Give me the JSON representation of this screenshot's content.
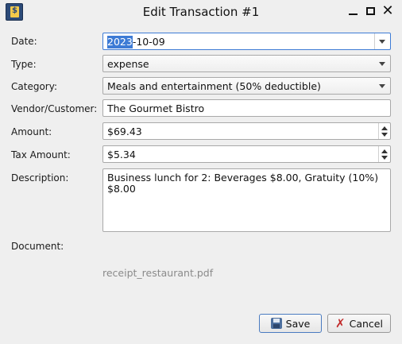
{
  "window": {
    "title": "Edit Transaction #1",
    "icons": [
      "app-icon",
      "minimize-icon",
      "maximize-icon",
      "close-icon"
    ]
  },
  "form": {
    "date": {
      "label": "Date:",
      "value_selected": "2023",
      "value_rest": "-10-09"
    },
    "type": {
      "label": "Type:",
      "value": "expense"
    },
    "category": {
      "label": "Category:",
      "value": "Meals and entertainment (50% deductible)"
    },
    "vendor": {
      "label": "Vendor/Customer:",
      "value": "The Gourmet Bistro"
    },
    "amount": {
      "label": "Amount:",
      "value": "$69.43"
    },
    "tax_amount": {
      "label": "Tax Amount:",
      "value": "$5.34"
    },
    "description": {
      "label": "Description:",
      "value": "Business lunch for 2: Beverages $8.00, Gratuity (10%) $8.00"
    },
    "document": {
      "label": "Document:",
      "filename": "receipt_restaurant.pdf"
    }
  },
  "buttons": {
    "save_label": "Save",
    "cancel_label": "Cancel"
  },
  "colors": {
    "selection": "#3d7bd5",
    "background": "#efefef",
    "cancel_icon": "#c22b2b"
  }
}
